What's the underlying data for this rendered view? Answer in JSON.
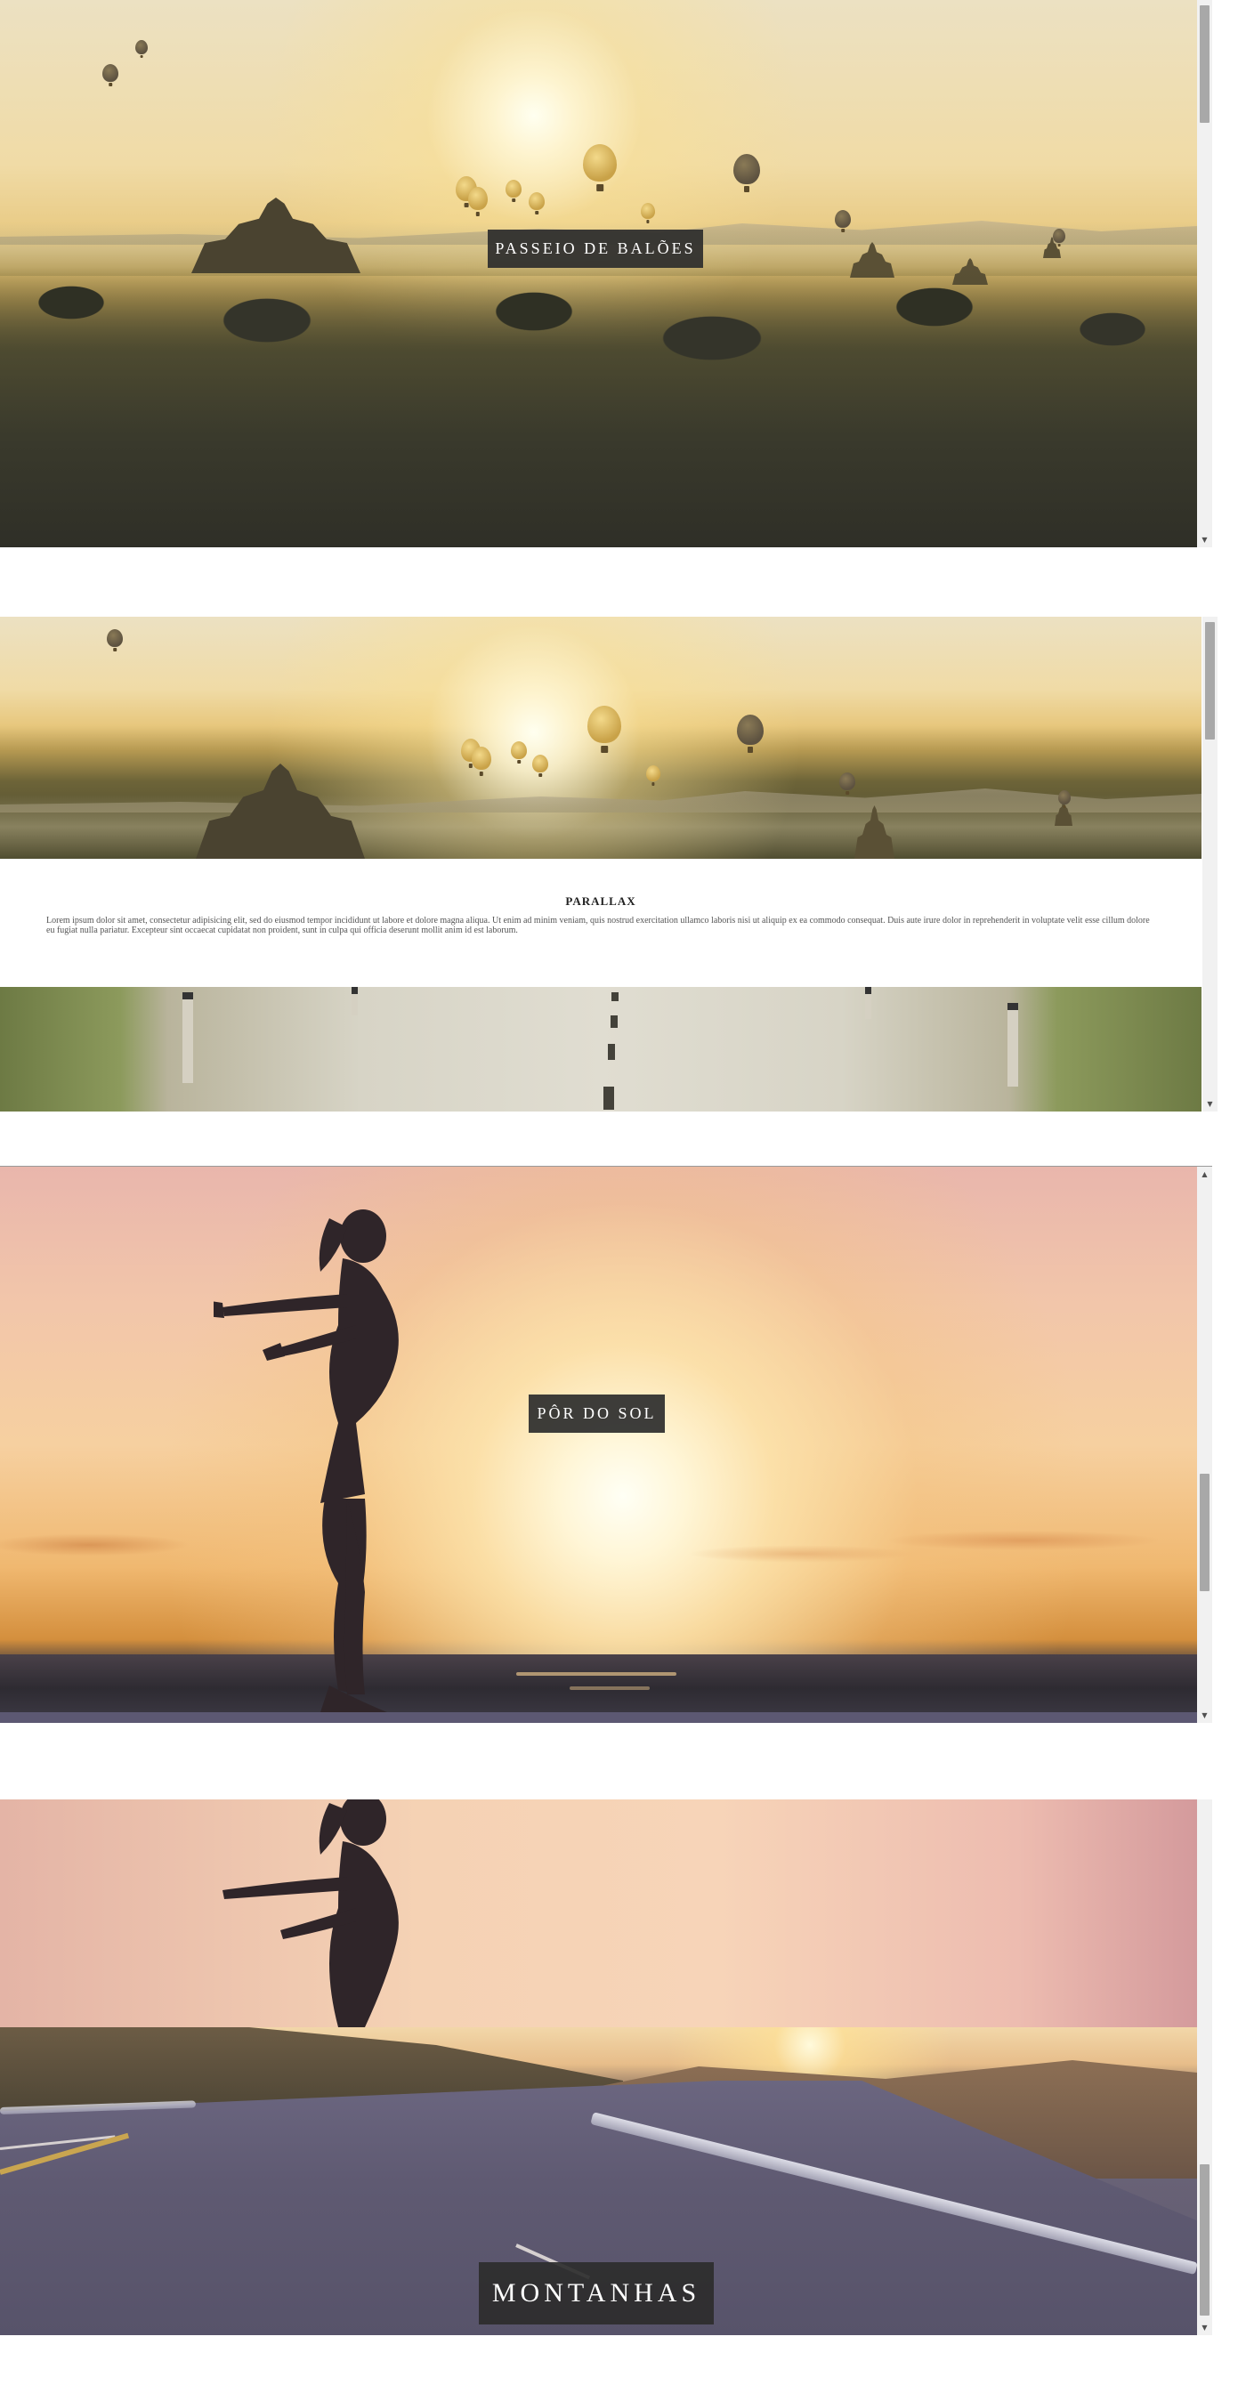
{
  "panel1": {
    "caption": "PASSEIO DE BALÕES"
  },
  "panel2": {
    "heading": "PARALLAX",
    "body": "Lorem ipsum dolor sit amet, consectetur adipisicing elit, sed do eiusmod tempor incididunt ut labore et dolore magna aliqua. Ut enim ad minim veniam, quis nostrud exercitation ullamco laboris nisi ut aliquip ex ea commodo consequat. Duis aute irure dolor in reprehenderit in voluptate velit esse cillum dolore eu fugiat nulla pariatur. Excepteur sint occaecat cupidatat non proident, sunt in culpa qui officia deserunt mollit anim id est laborum."
  },
  "panel3": {
    "caption": "PÔR DO SOL"
  },
  "panel4": {
    "caption": "MONTANHAS"
  },
  "scrollbar": {
    "arrow_up": "▲",
    "arrow_down": "▼"
  }
}
